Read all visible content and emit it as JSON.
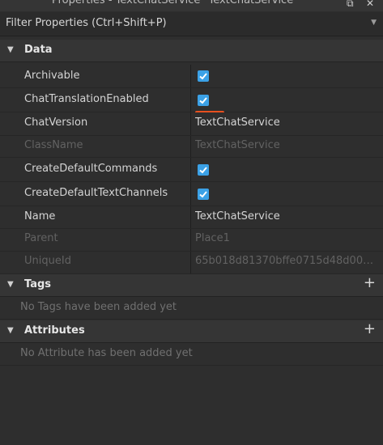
{
  "window": {
    "title": "Properties - TextChatService \"TextChatService\"",
    "popout_icon": "popout-icon",
    "close_icon": "close-icon"
  },
  "filter": {
    "placeholder": "Filter Properties (Ctrl+Shift+P)"
  },
  "sections": {
    "data": {
      "title": "Data",
      "rows": [
        {
          "name": "Archivable",
          "value": "",
          "checked": true
        },
        {
          "name": "ChatTranslationEnabled",
          "value": "",
          "checked": true
        },
        {
          "name": "ChatVersion",
          "value": "TextChatService"
        },
        {
          "name": "ClassName",
          "value": "TextChatService",
          "readonly": true
        },
        {
          "name": "CreateDefaultCommands",
          "value": "",
          "checked": true
        },
        {
          "name": "CreateDefaultTextChannels",
          "value": "",
          "checked": true
        },
        {
          "name": "Name",
          "value": "TextChatService"
        },
        {
          "name": "Parent",
          "value": "Place1",
          "readonly": true
        },
        {
          "name": "UniqueId",
          "value": "65b018d81370bffe0715d48d0000...",
          "readonly": true
        }
      ]
    },
    "tags": {
      "title": "Tags",
      "empty": "No Tags have been added yet"
    },
    "attributes": {
      "title": "Attributes",
      "empty": "No Attribute has been added yet"
    }
  },
  "colors": {
    "checkbox": "#3ba1e6",
    "annotation_underline": "#e8501f"
  }
}
